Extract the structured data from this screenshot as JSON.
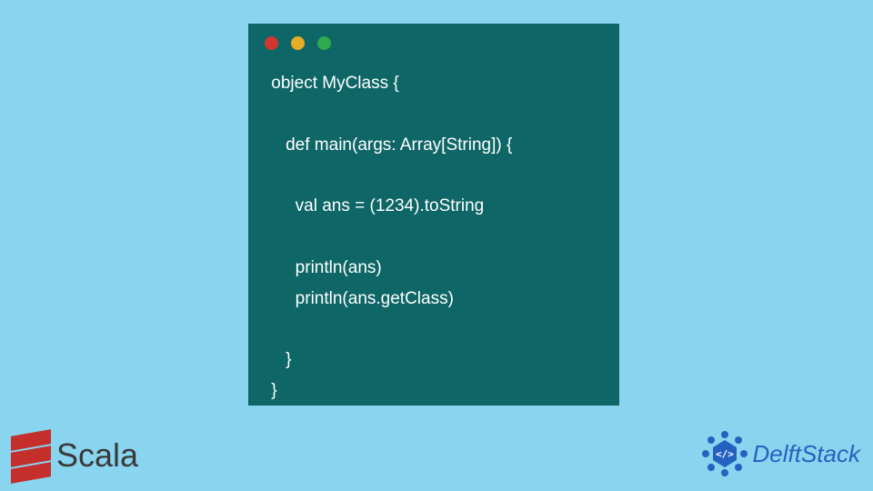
{
  "colors": {
    "background": "#89d4ef",
    "window_bg": "#0e6666",
    "red": "#d0362f",
    "yellow": "#e8ad25",
    "green": "#2fa84f",
    "scala_red": "#c42e2b",
    "delft_blue": "#2562c0"
  },
  "window": {
    "traffic": {
      "red": "close",
      "yellow": "minimize",
      "green": "zoom"
    }
  },
  "code": {
    "line1": " object MyClass {",
    "line2": "",
    "line3": "    def main(args: Array[String]) {",
    "line4": "",
    "line5": "      val ans = (1234).toString",
    "line6": "",
    "line7": "      println(ans)",
    "line8": "      println(ans.getClass)",
    "line9": "",
    "line10": "    }",
    "line11": " }"
  },
  "logos": {
    "scala": "Scala",
    "delft": "DelftStack",
    "delft_badge_text": "</>"
  }
}
